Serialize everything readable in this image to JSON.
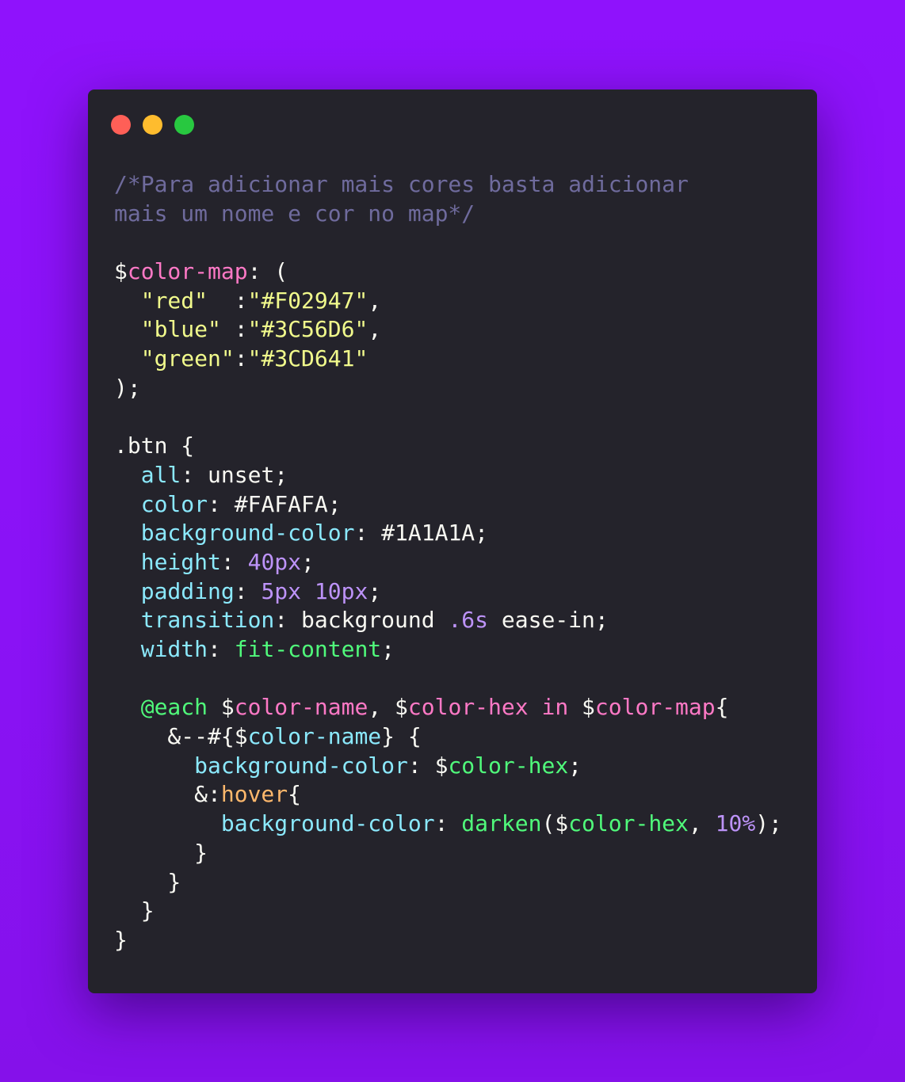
{
  "window": {
    "buttons": [
      {
        "name": "close",
        "color": "#ff5f57"
      },
      {
        "name": "minimize",
        "color": "#febc2e"
      },
      {
        "name": "zoom",
        "color": "#28c840"
      }
    ]
  },
  "colors": {
    "background": "#8f12fc",
    "editor_background": "#24232b",
    "comment": "#6f6b9d",
    "default": "#f8f8f2",
    "variable": "#ff79c6",
    "string": "#f1fa8c",
    "property": "#8be9fd",
    "number": "#bd93f9",
    "function": "#50fa7b",
    "at_rule": "#50fa7b",
    "pseudo": "#ffb86c"
  },
  "code_lines": [
    [
      {
        "t": "/*Para adicionar mais cores basta adicionar",
        "c": "comment"
      }
    ],
    [
      {
        "t": "mais um nome e cor no map*/",
        "c": "comment"
      }
    ],
    [],
    [
      {
        "t": "$",
        "c": "default"
      },
      {
        "t": "color-map",
        "c": "variable"
      },
      {
        "t": ": (",
        "c": "default"
      }
    ],
    [
      {
        "t": "  ",
        "c": "default"
      },
      {
        "t": "\"red\"",
        "c": "string"
      },
      {
        "t": "  :",
        "c": "default"
      },
      {
        "t": "\"#F02947\"",
        "c": "string"
      },
      {
        "t": ",",
        "c": "default"
      }
    ],
    [
      {
        "t": "  ",
        "c": "default"
      },
      {
        "t": "\"blue\"",
        "c": "string"
      },
      {
        "t": " :",
        "c": "default"
      },
      {
        "t": "\"#3C56D6\"",
        "c": "string"
      },
      {
        "t": ",",
        "c": "default"
      }
    ],
    [
      {
        "t": "  ",
        "c": "default"
      },
      {
        "t": "\"green\"",
        "c": "string"
      },
      {
        "t": ":",
        "c": "default"
      },
      {
        "t": "\"#3CD641\"",
        "c": "string"
      }
    ],
    [
      {
        "t": ");",
        "c": "default"
      }
    ],
    [],
    [
      {
        "t": ".btn {",
        "c": "default"
      }
    ],
    [
      {
        "t": "  ",
        "c": "default"
      },
      {
        "t": "all",
        "c": "property"
      },
      {
        "t": ": unset;",
        "c": "default"
      }
    ],
    [
      {
        "t": "  ",
        "c": "default"
      },
      {
        "t": "color",
        "c": "property"
      },
      {
        "t": ": #FAFAFA;",
        "c": "default"
      }
    ],
    [
      {
        "t": "  ",
        "c": "default"
      },
      {
        "t": "background-color",
        "c": "property"
      },
      {
        "t": ": #1A1A1A;",
        "c": "default"
      }
    ],
    [
      {
        "t": "  ",
        "c": "default"
      },
      {
        "t": "height",
        "c": "property"
      },
      {
        "t": ": ",
        "c": "default"
      },
      {
        "t": "40px",
        "c": "number"
      },
      {
        "t": ";",
        "c": "default"
      }
    ],
    [
      {
        "t": "  ",
        "c": "default"
      },
      {
        "t": "padding",
        "c": "property"
      },
      {
        "t": ": ",
        "c": "default"
      },
      {
        "t": "5px",
        "c": "number"
      },
      {
        "t": " ",
        "c": "default"
      },
      {
        "t": "10px",
        "c": "number"
      },
      {
        "t": ";",
        "c": "default"
      }
    ],
    [
      {
        "t": "  ",
        "c": "default"
      },
      {
        "t": "transition",
        "c": "property"
      },
      {
        "t": ": background ",
        "c": "default"
      },
      {
        "t": ".6s",
        "c": "number"
      },
      {
        "t": " ease-in;",
        "c": "default"
      }
    ],
    [
      {
        "t": "  ",
        "c": "default"
      },
      {
        "t": "width",
        "c": "property"
      },
      {
        "t": ": ",
        "c": "default"
      },
      {
        "t": "fit-content",
        "c": "function"
      },
      {
        "t": ";",
        "c": "default"
      }
    ],
    [],
    [
      {
        "t": "  ",
        "c": "default"
      },
      {
        "t": "@each",
        "c": "at_rule"
      },
      {
        "t": " $",
        "c": "default"
      },
      {
        "t": "color-name",
        "c": "variable"
      },
      {
        "t": ", $",
        "c": "default"
      },
      {
        "t": "color-hex",
        "c": "variable"
      },
      {
        "t": " ",
        "c": "default"
      },
      {
        "t": "in",
        "c": "variable"
      },
      {
        "t": " $",
        "c": "default"
      },
      {
        "t": "color-map",
        "c": "variable"
      },
      {
        "t": "{",
        "c": "default"
      }
    ],
    [
      {
        "t": "    &--#{$",
        "c": "default"
      },
      {
        "t": "color-name",
        "c": "property"
      },
      {
        "t": "} {",
        "c": "default"
      }
    ],
    [
      {
        "t": "      ",
        "c": "default"
      },
      {
        "t": "background-color",
        "c": "property"
      },
      {
        "t": ": $",
        "c": "default"
      },
      {
        "t": "color-hex",
        "c": "function"
      },
      {
        "t": ";",
        "c": "default"
      }
    ],
    [
      {
        "t": "      &:",
        "c": "default"
      },
      {
        "t": "hover",
        "c": "pseudo"
      },
      {
        "t": "{",
        "c": "default"
      }
    ],
    [
      {
        "t": "        ",
        "c": "default"
      },
      {
        "t": "background-color",
        "c": "property"
      },
      {
        "t": ": ",
        "c": "default"
      },
      {
        "t": "darken",
        "c": "function"
      },
      {
        "t": "($",
        "c": "default"
      },
      {
        "t": "color-hex",
        "c": "function"
      },
      {
        "t": ", ",
        "c": "default"
      },
      {
        "t": "10%",
        "c": "number"
      },
      {
        "t": ");",
        "c": "default"
      }
    ],
    [
      {
        "t": "      }",
        "c": "default"
      }
    ],
    [
      {
        "t": "    }",
        "c": "default"
      }
    ],
    [
      {
        "t": "  }",
        "c": "default"
      }
    ],
    [
      {
        "t": "}",
        "c": "default"
      }
    ]
  ]
}
